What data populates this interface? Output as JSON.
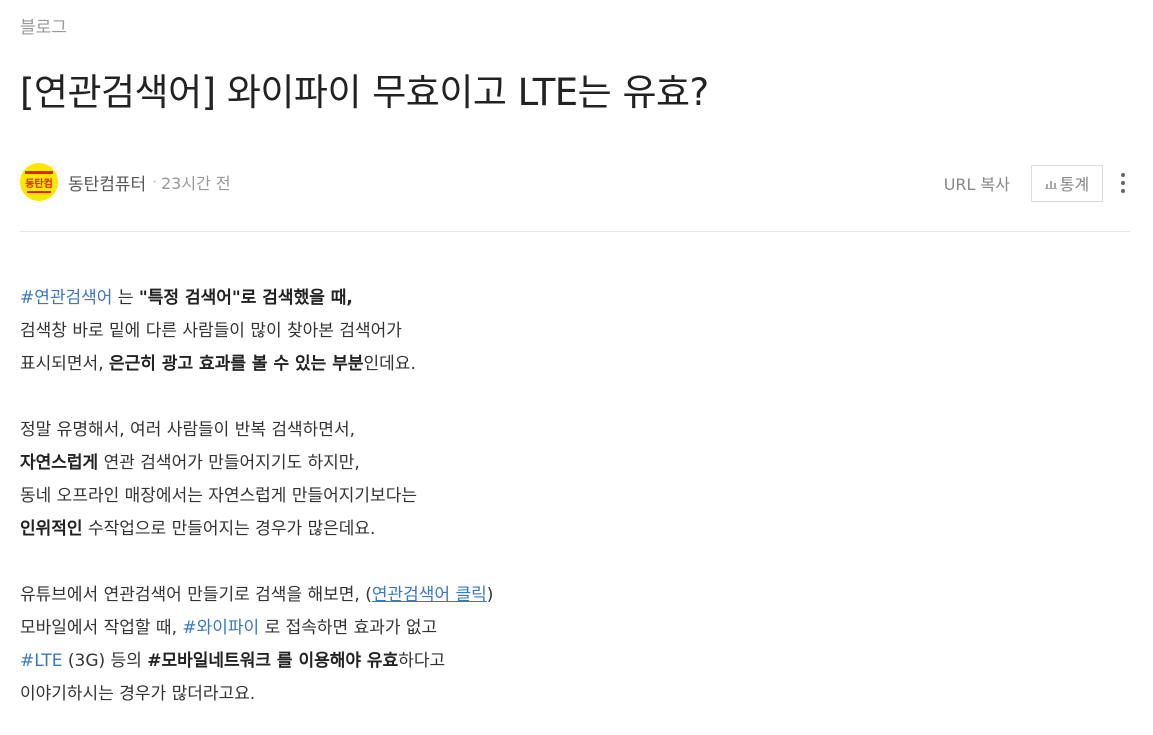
{
  "category": "블로그",
  "title": "[연관검색어] 와이파이 무효이고 LTE는 유효?",
  "author": {
    "name": "동탄컴퓨터",
    "avatar_text": "동탄컴",
    "time": "23시간 전"
  },
  "actions": {
    "url_copy": "URL 복사",
    "stats": "통계"
  },
  "colors": {
    "link": "#3a78c2",
    "avatar_bg": "#ffe600",
    "avatar_text": "#e0201a"
  },
  "body": {
    "p1": {
      "l1_tag": "#연관검색어",
      "l1_t1": " 는 ",
      "l1_b1": "\"특정 검색어\"로 검색했을 때,",
      "l2": "검색창 바로 밑에 다른 사람들이 많이 찾아본 검색어가",
      "l3_t1": "표시되면서, ",
      "l3_b1": "은근히 광고 효과를 볼 수 있는 부분",
      "l3_t2": "인데요."
    },
    "p2": {
      "l1": "정말 유명해서, 여러 사람들이 반복 검색하면서,",
      "l2_b1": "자연스럽게",
      "l2_t1": " 연관 검색어가 만들어지기도 하지만,",
      "l3": "동네 오프라인 매장에서는 자연스럽게 만들어지기보다는",
      "l4_b1": "인위적인",
      "l4_t1": " 수작업으로 만들어지는 경우가 많은데요."
    },
    "p3": {
      "l1_t1": "유튜브에서 연관검색어 만들기로 검색을 해보면, (",
      "l1_link": "연관검색어 클릭",
      "l1_t2": ")",
      "l2_t1": "모바일에서 작업할 때, ",
      "l2_tag": "#와이파이",
      "l2_t2": " 로 접속하면 효과가 없고",
      "l3_tag": "#LTE",
      "l3_t1": " (3G) 등의 ",
      "l3_b1": "#모바일네트워크 를 이용해야 유효",
      "l3_t2": "하다고",
      "l4": "이야기하시는 경우가 많더라고요."
    }
  }
}
